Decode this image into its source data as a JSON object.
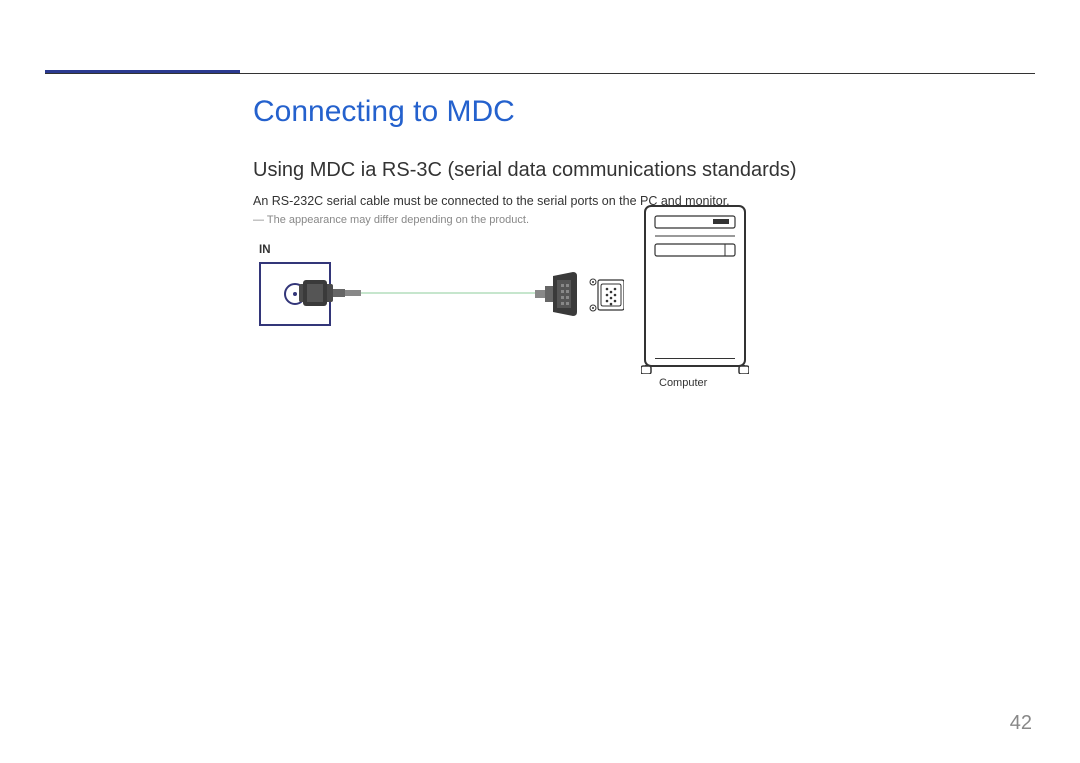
{
  "title": "Connecting to MDC",
  "subtitle": "Using MDC ia RS-​3C ​(serial data communications standards)",
  "body": "An RS-232C serial cable must be connected to the serial ports on the PC and monitor.",
  "note": "The appearance may differ depending on the product.",
  "diagram": {
    "port_label": "​IN",
    "computer_label": "Computer"
  },
  "page_number": "42"
}
